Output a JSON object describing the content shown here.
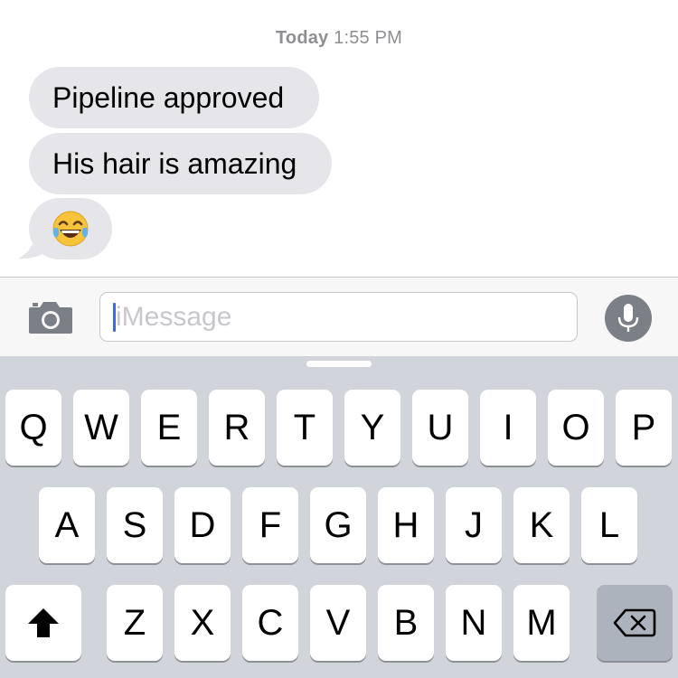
{
  "thread": {
    "timestamp_day": "Today",
    "timestamp_time": " 1:55 PM",
    "messages": [
      {
        "text": "Pipeline approved"
      },
      {
        "text": "His hair is amazing"
      },
      {
        "emoji": "face-with-tears-of-joy"
      }
    ]
  },
  "input": {
    "placeholder": "iMessage",
    "camera_icon": "camera-icon",
    "mic_icon": "microphone-icon"
  },
  "keyboard": {
    "row1": [
      "Q",
      "W",
      "E",
      "R",
      "T",
      "Y",
      "U",
      "I",
      "O",
      "P"
    ],
    "row2": [
      "A",
      "S",
      "D",
      "F",
      "G",
      "H",
      "J",
      "K",
      "L"
    ],
    "row3": [
      "Z",
      "X",
      "C",
      "V",
      "B",
      "N",
      "M"
    ],
    "shift_icon": "shift-arrow-icon",
    "delete_icon": "backspace-icon"
  },
  "colors": {
    "bubble_gray": "#e5e5ea",
    "keyboard_bg": "#d1d4db",
    "special_key": "#acb3bc",
    "caret_blue": "#3f6bd9"
  }
}
